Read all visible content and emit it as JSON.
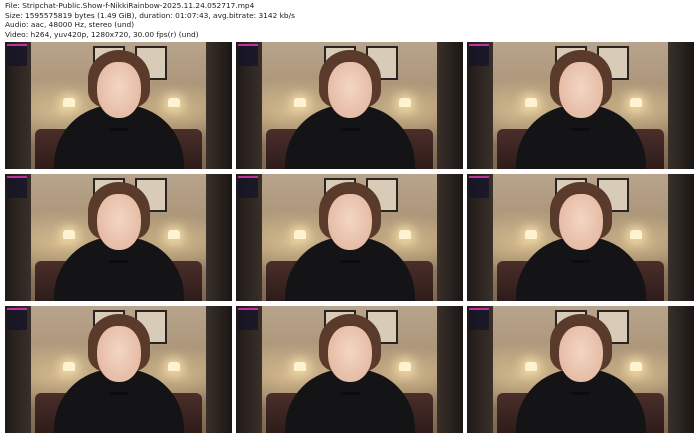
{
  "header": {
    "line1": "File: Stripchat-Public.Show-f-NikkiRainbow-2025.11.24.052717.mp4",
    "line2": "Size: 1595575819 bytes (1.49 GiB), duration: 01:07:43, avg.bitrate: 3142 kb/s",
    "line3": "Audio: aac, 48000 Hz, stereo (und)",
    "line4": "Video: h264, yuv420p, 1280x720, 30.00 fps(r) (und)"
  },
  "thumbnails": [
    {
      "label": "frame-1"
    },
    {
      "label": "frame-2"
    },
    {
      "label": "frame-3"
    },
    {
      "label": "frame-4"
    },
    {
      "label": "frame-5"
    },
    {
      "label": "frame-6"
    },
    {
      "label": "frame-7"
    },
    {
      "label": "frame-8"
    },
    {
      "label": "frame-9"
    }
  ]
}
